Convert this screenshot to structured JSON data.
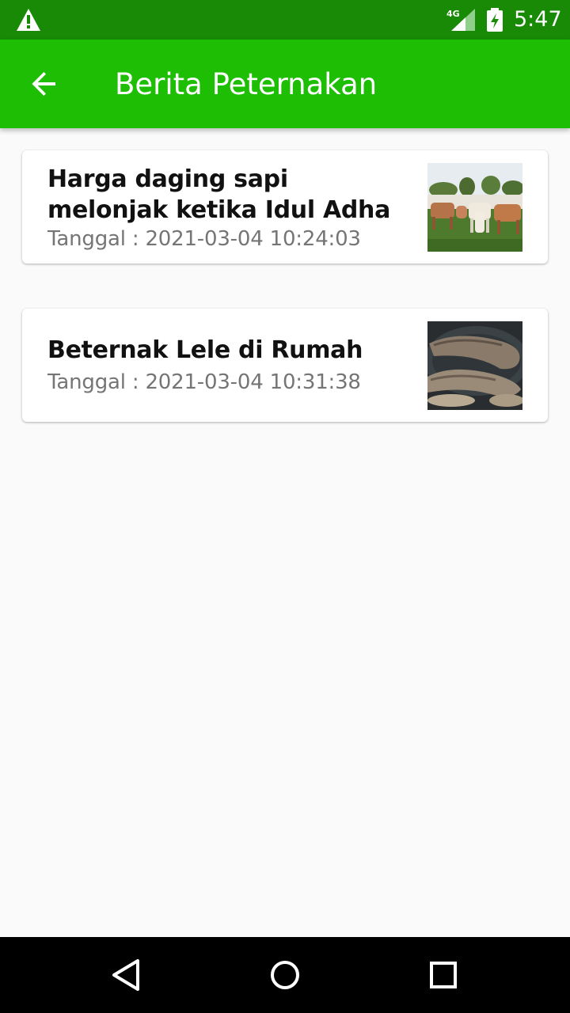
{
  "status_bar": {
    "network_label": "4G",
    "time": "5:47",
    "icons": [
      "warning-icon",
      "cellular-signal-icon",
      "battery-charging-icon"
    ]
  },
  "app_bar": {
    "title": "Berita Peternakan",
    "back_icon": "arrow-back-icon"
  },
  "news": [
    {
      "title": "Harga daging sapi melonjak ketika Idul Adha",
      "date": "Tanggal : 2021-03-04 10:24:03",
      "thumbnail": "cattle-herd-photo"
    },
    {
      "title": "Beternak Lele di Rumah",
      "date": "Tanggal : 2021-03-04 10:31:38",
      "thumbnail": "catfish-photo"
    }
  ],
  "nav_bar": {
    "buttons": [
      "back-triangle-icon",
      "home-circle-icon",
      "recents-square-icon"
    ]
  },
  "colors": {
    "status_bar": "#188a06",
    "app_bar": "#1ebe05",
    "background": "#fafafa",
    "date_text": "#757575"
  }
}
